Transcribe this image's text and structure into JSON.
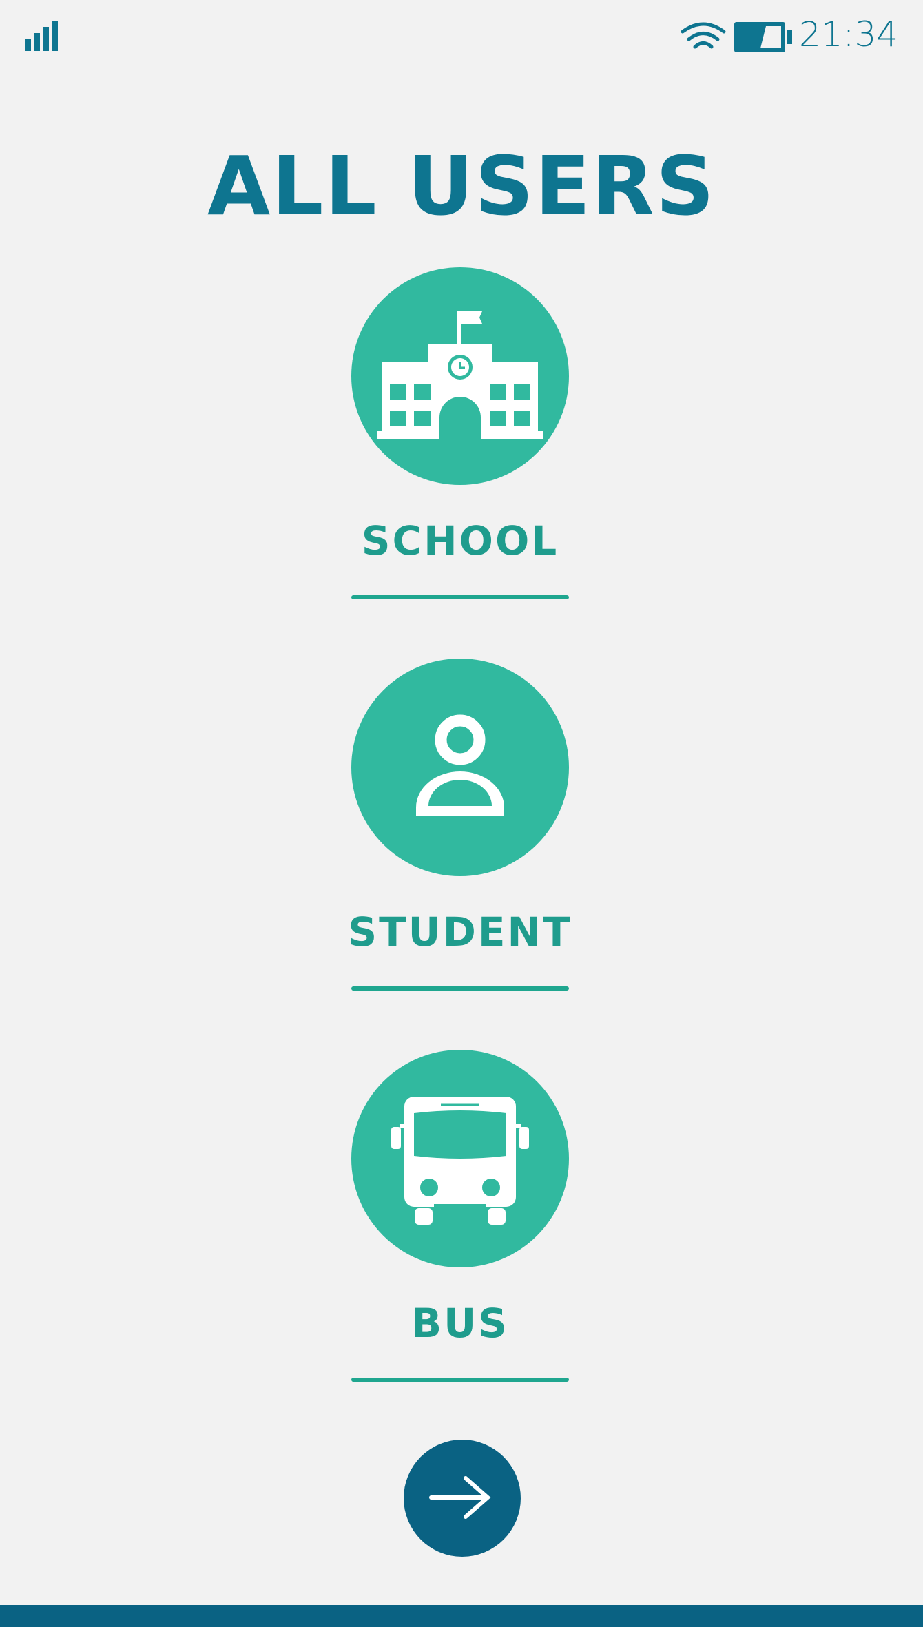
{
  "status_bar": {
    "time": "21:34",
    "icons": [
      "signal-icon",
      "wifi-icon",
      "battery-icon"
    ]
  },
  "title": "ALL USERS",
  "options": [
    {
      "label": "SCHOOL",
      "icon": "school-icon"
    },
    {
      "label": "STUDENT",
      "icon": "student-icon"
    },
    {
      "label": "BUS",
      "icon": "bus-icon"
    }
  ],
  "next_button": {
    "icon": "arrow-right-icon"
  },
  "colors": {
    "background": "#f2f2f2",
    "title": "#0e7590",
    "accent": "#31b99f",
    "label": "#1f9c8d",
    "primary_dark": "#0a6283"
  }
}
